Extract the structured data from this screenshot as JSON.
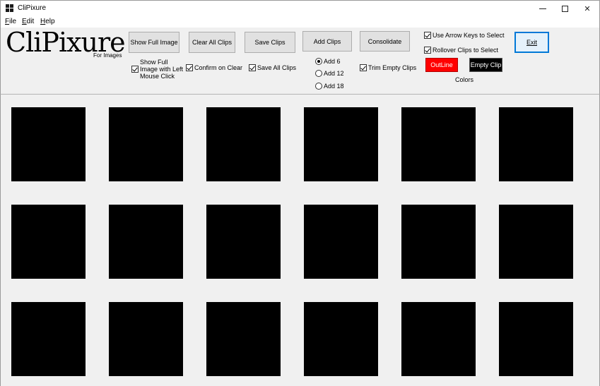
{
  "window": {
    "title": "CliPixure",
    "icons": [
      "app-icon",
      "minimize-icon",
      "maximize-icon",
      "close-icon"
    ]
  },
  "menu": [
    {
      "key": "F",
      "rest": "ile"
    },
    {
      "key": "E",
      "rest": "dit"
    },
    {
      "key": "H",
      "rest": "elp"
    }
  ],
  "logo": {
    "title": "CliPixure",
    "subtitle": "For Images"
  },
  "buttons": {
    "show_full_image": "Show Full Image",
    "clear_all_clips": "Clear All Clips",
    "save_clips": "Save Clips",
    "add_clips": "Add Clips",
    "consolidate": "Consolidate",
    "exit": "Exit"
  },
  "options": {
    "show_full_left_click": {
      "label": "Show Full Image with Left Mouse Click",
      "checked": true
    },
    "confirm_on_clear": {
      "label": "Confirm on Clear",
      "checked": true
    },
    "save_all_clips": {
      "label": "Save All Clips",
      "checked": true
    },
    "trim_empty_clips": {
      "label": "Trim Empty Clips",
      "checked": true
    },
    "use_arrow_keys": {
      "label": "Use Arrow Keys to Select",
      "checked": true
    },
    "rollover_clips": {
      "label": "Rollover Clips to Select",
      "checked": true
    }
  },
  "add_count": {
    "options": [
      "Add 6",
      "Add 12",
      "Add 18"
    ],
    "selected": "Add 6"
  },
  "colors": {
    "label": "Colors",
    "outline": {
      "label": "OutLine",
      "color": "#ff0000"
    },
    "empty_clip": {
      "label": "Empty Clip",
      "color": "#000000"
    }
  },
  "clips": {
    "rows": 3,
    "columns": 6,
    "fill": "#000000"
  }
}
